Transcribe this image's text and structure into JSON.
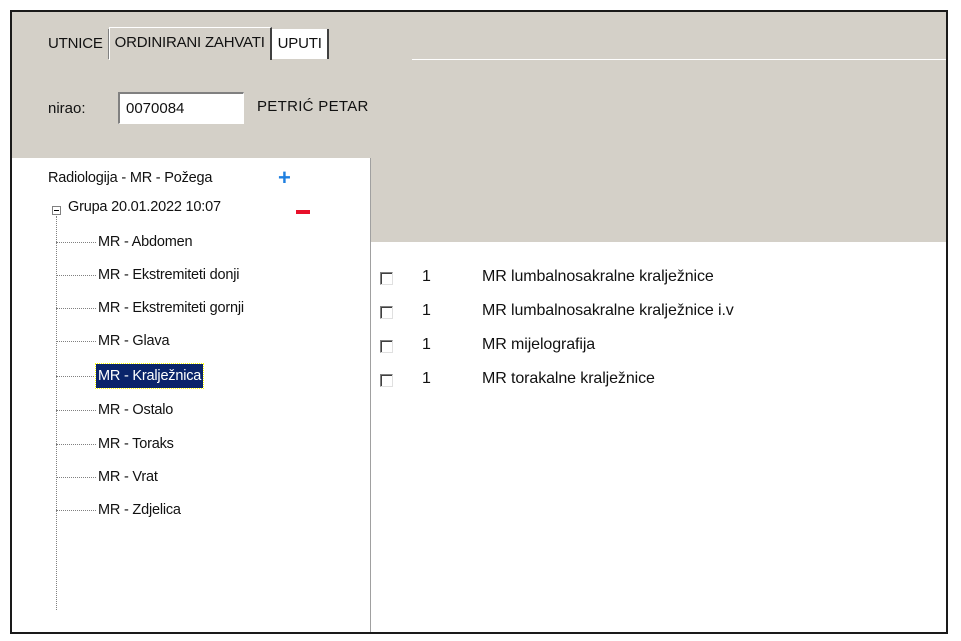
{
  "tabs": [
    {
      "label": "UTNICE",
      "active": false
    },
    {
      "label": "ORDINIRANI ZAHVATI",
      "active": true
    },
    {
      "label": "UPUTI",
      "active": false
    }
  ],
  "ordinirao": {
    "label": "nirao:",
    "code": "0070084",
    "name": "PETRIĆ PETAR"
  },
  "tree": {
    "root": {
      "label": "Radiologija - MR - Požega",
      "icon": "plus-icon"
    },
    "group": {
      "label": "Grupa 20.01.2022 10:07",
      "icon": "minus-icon"
    },
    "items": [
      {
        "label": "MR - Abdomen",
        "selected": false
      },
      {
        "label": "MR - Ekstremiteti donji",
        "selected": false
      },
      {
        "label": "MR - Ekstremiteti gornji",
        "selected": false
      },
      {
        "label": "MR - Glava",
        "selected": false
      },
      {
        "label": "MR - Kralježnica",
        "selected": true
      },
      {
        "label": "MR - Ostalo",
        "selected": false
      },
      {
        "label": "MR - Toraks",
        "selected": false
      },
      {
        "label": "MR - Vrat",
        "selected": false
      },
      {
        "label": "MR - Zdjelica",
        "selected": false
      }
    ]
  },
  "procedures": [
    {
      "checked": false,
      "qty": "1",
      "name": "MR lumbalnosakralne kralježnice"
    },
    {
      "checked": false,
      "qty": "1",
      "name": "MR lumbalnosakralne kralježnice i.v"
    },
    {
      "checked": false,
      "qty": "1",
      "name": "MR mijelografija"
    },
    {
      "checked": false,
      "qty": "1",
      "name": "MR torakalne kralježnice"
    }
  ],
  "colors": {
    "panel": "#d4d0c8",
    "selection": "#0a246a",
    "plus": "#1e7fe0",
    "minus": "#e8102a"
  }
}
